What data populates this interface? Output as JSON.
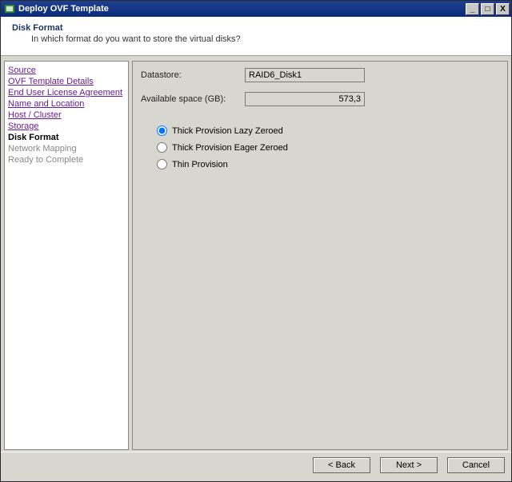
{
  "title": "Deploy OVF Template",
  "header": {
    "title": "Disk Format",
    "subtitle": "In which format do you want to store the virtual disks?"
  },
  "sidebar": {
    "items": [
      {
        "label": "Source",
        "state": "visited"
      },
      {
        "label": "OVF Template Details",
        "state": "visited"
      },
      {
        "label": "End User License Agreement",
        "state": "visited"
      },
      {
        "label": "Name and Location",
        "state": "visited"
      },
      {
        "label": "Host / Cluster",
        "state": "visited"
      },
      {
        "label": "Storage",
        "state": "visited"
      },
      {
        "label": "Disk Format",
        "state": "current"
      },
      {
        "label": "Network Mapping",
        "state": "disabled"
      },
      {
        "label": "Ready to Complete",
        "state": "disabled"
      }
    ]
  },
  "content": {
    "datastore_label": "Datastore:",
    "datastore_value": "RAID6_Disk1",
    "space_label": "Available space (GB):",
    "space_value": "573,3",
    "radio_options": [
      {
        "label": "Thick Provision Lazy Zeroed",
        "selected": true
      },
      {
        "label": "Thick Provision Eager Zeroed",
        "selected": false
      },
      {
        "label": "Thin Provision",
        "selected": false
      }
    ]
  },
  "buttons": {
    "back": "< Back",
    "next": "Next >",
    "cancel": "Cancel"
  },
  "win_btn_glyphs": {
    "min": "_",
    "max": "□",
    "close": "X"
  }
}
